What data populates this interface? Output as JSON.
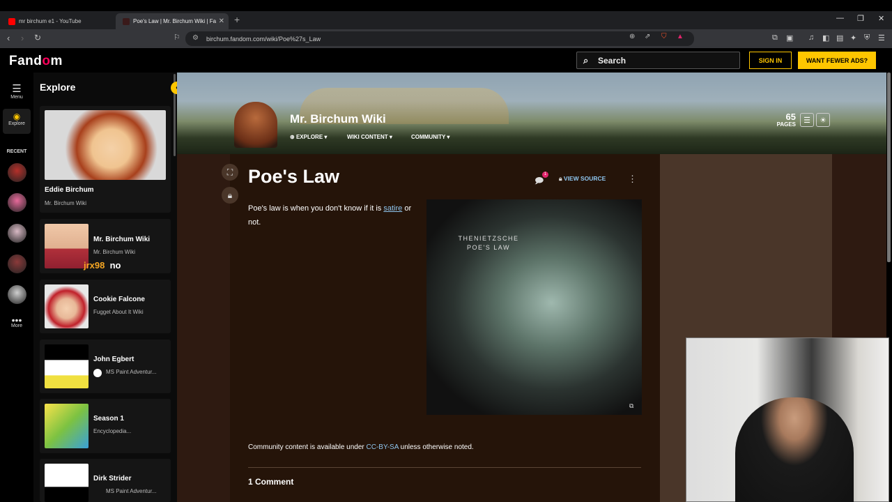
{
  "browser": {
    "tabs": [
      {
        "label": "mr birchum e1 - YouTube",
        "active": false,
        "favicon_color": "#ff0000"
      },
      {
        "label": "Poe's Law | Mr. Birchum Wiki | Fa",
        "active": true,
        "favicon_color": "#fa005a"
      }
    ],
    "new_tab": "+",
    "url": "birchum.fandom.com/wiki/Poe%27s_Law",
    "window_controls": [
      "minimize",
      "maximize",
      "close"
    ]
  },
  "header": {
    "logo_prefix": "Fand",
    "logo_o": "o",
    "logo_suffix": "m",
    "search_placeholder": "Search",
    "sign_in": "SIGN IN",
    "fewer_ads": "WANT FEWER ADS?"
  },
  "rail": {
    "menu": "Menu",
    "explore": "Explore",
    "recent": "RECENT",
    "more": "More",
    "avatar_colors": [
      "#b4302a",
      "#e66a9a",
      "#d8b9c4",
      "#8b3a3a",
      "#cfcfcf"
    ]
  },
  "explore_panel": {
    "title": "Explore",
    "cards": [
      {
        "title": "Eddie Birchum",
        "subtitle": "Mr. Birchum Wiki"
      },
      {
        "title": "Mr. Birchum Wiki",
        "subtitle": "Mr. Birchum Wiki"
      },
      {
        "title": "Cookie Falcone",
        "subtitle": "Fugget About It Wiki"
      },
      {
        "title": "John Egbert",
        "subtitle": "MS Paint Adventur..."
      },
      {
        "title": "Season 1",
        "subtitle": "Encyclopedia..."
      },
      {
        "title": "Dirk Strider",
        "subtitle": "MS Paint Adventur..."
      }
    ],
    "chat_overlay": {
      "user": "jrx98",
      "message": "no",
      "user_color": "#f5a623"
    }
  },
  "wiki": {
    "name": "Mr. Birchum Wiki",
    "nav": [
      "EXPLORE",
      "WIKI CONTENT",
      "COMMUNITY"
    ],
    "pages_count": "65",
    "pages_label": "PAGES"
  },
  "article": {
    "title": "Poe's Law",
    "comment_badge": "1",
    "view_source": "VIEW SOURCE",
    "body_pre": "Poe's law is when you don't know if it is ",
    "body_link": "satire",
    "body_post": " or not.",
    "image_caption_line1": "THENIETZSCHE",
    "image_caption_line2": "POE'S LAW",
    "license_pre": "Community content is available under ",
    "license_link": "CC-BY-SA",
    "license_post": " unless otherwise noted.",
    "comments_heading": "1 Comment"
  }
}
